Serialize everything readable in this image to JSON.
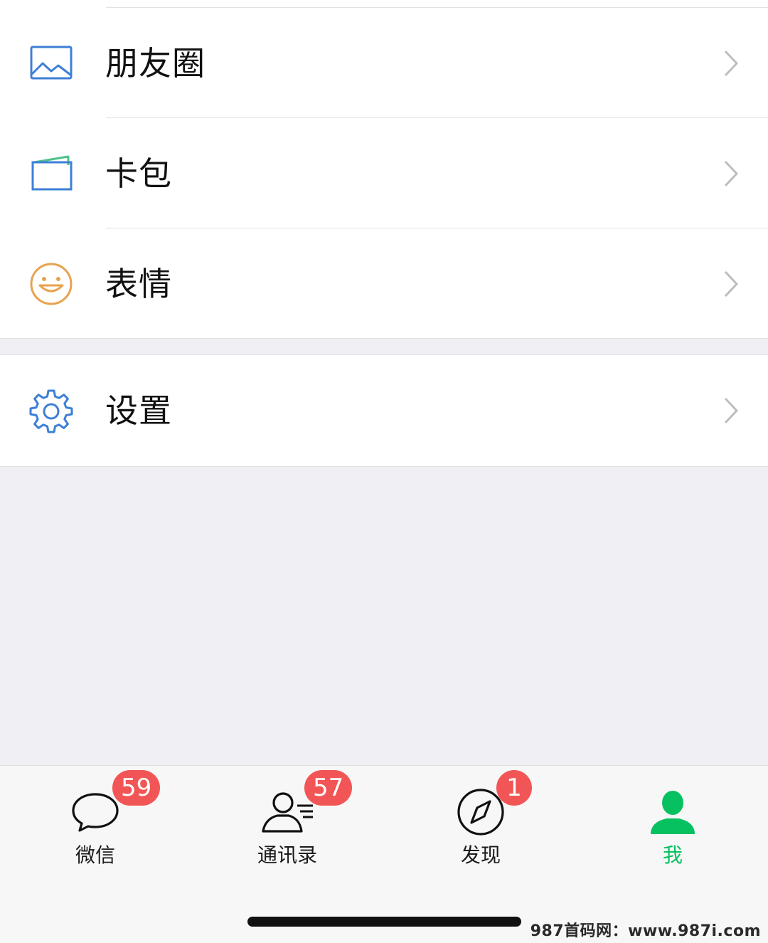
{
  "menu": {
    "moments_label": "朋友圈",
    "cards_label": "卡包",
    "stickers_label": "表情",
    "settings_label": "设置"
  },
  "tabs": [
    {
      "label": "微信",
      "badge": "59",
      "icon": "chat-bubble-icon"
    },
    {
      "label": "通讯录",
      "badge": "57",
      "icon": "contacts-icon"
    },
    {
      "label": "发现",
      "badge": "1",
      "icon": "compass-icon"
    },
    {
      "label": "我",
      "badge": "",
      "icon": "person-icon"
    }
  ],
  "colors": {
    "accent": "#07c160",
    "badge": "#f25555",
    "icon_blue": "#3d7fd6",
    "icon_orange": "#e8a24f"
  },
  "watermark": "987首码网：www.987i.com"
}
